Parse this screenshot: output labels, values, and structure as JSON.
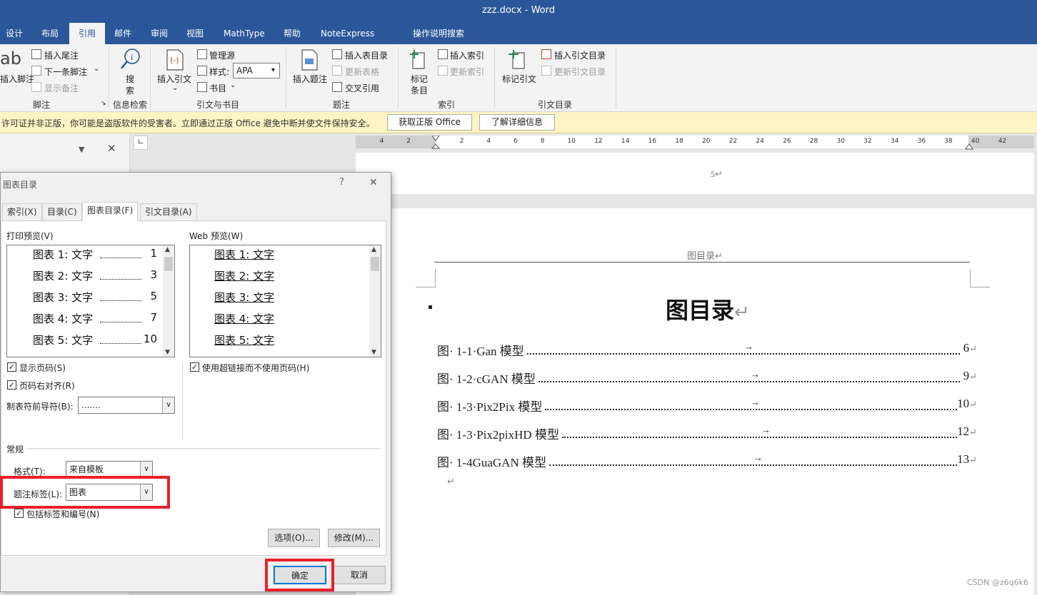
{
  "window": {
    "title": "zzz.docx  -  Word"
  },
  "menu_tabs": [
    {
      "label": "设计"
    },
    {
      "label": "布局"
    },
    {
      "label": "引用"
    },
    {
      "label": "邮件"
    },
    {
      "label": "审阅"
    },
    {
      "label": "视图"
    },
    {
      "label": "MathType"
    },
    {
      "label": "帮助"
    },
    {
      "label": "NoteExpress"
    },
    {
      "label": "操作说明搜索"
    }
  ],
  "ribbon": {
    "footnote": {
      "big_label": "插入脚注",
      "insert_endnote": "插入尾注",
      "next_footnote": "下一条脚注",
      "show_notes": "显示备注",
      "group": "脚注"
    },
    "search": {
      "label_1": "搜",
      "label_2": "索",
      "group": "信息检索"
    },
    "citations": {
      "insert_citation": "插入引文",
      "manage_sources": "管理源",
      "style_label": "样式:",
      "style_value": "APA",
      "bibliography": "书目",
      "group": "引文与书目"
    },
    "captions": {
      "insert_caption": "插入题注",
      "insert_table_of_figures": "插入表目录",
      "update_table": "更新表格",
      "cross_reference": "交叉引用",
      "group": "题注"
    },
    "index": {
      "mark_entry_1": "标记",
      "mark_entry_2": "条目",
      "insert_index": "插入索引",
      "update_index": "更新索引",
      "group": "索引"
    },
    "toa": {
      "mark_citation": "标记引文",
      "insert_toa": "插入引文目录",
      "update_toa": "更新引文目录",
      "group": "引文目录"
    },
    "big_icon_text": "ab"
  },
  "message_bar": {
    "text": "许可证并非正版，你可能是盗版软件的受害者。立即通过正版 Office 避免中断并使文件保持安全。",
    "btn_genuine": "获取正版 Office",
    "btn_learn": "了解详细信息"
  },
  "ruler": {
    "numbers_left": [
      "4",
      "2"
    ],
    "numbers": [
      "2",
      "4",
      "6",
      "8",
      "10",
      "12",
      "14",
      "16",
      "18",
      "20",
      "22",
      "24",
      "26",
      "28",
      "30",
      "32",
      "34",
      "36",
      "38"
    ],
    "numbers_right": [
      "40",
      "42"
    ]
  },
  "document": {
    "page1_number": "5",
    "header_text": "图目录",
    "heading": "图目录",
    "entries": [
      {
        "label": "图· 1-1·Gan 模型",
        "page": "6"
      },
      {
        "label": "图· 1-2·cGAN 模型",
        "page": "9"
      },
      {
        "label": "图· 1-3·Pix2Pix 模型",
        "page": "10"
      },
      {
        "label": "图· 1-3·Pix2pixHD 模型",
        "page": "12"
      },
      {
        "label": "图· 1-4GuaGAN 模型",
        "page": "13"
      }
    ],
    "return_mark": "↵",
    "tab_arrow": "→"
  },
  "dialog": {
    "title": "图表目录",
    "help": "?",
    "close": "✕",
    "tabs": [
      {
        "label": "索引(X)"
      },
      {
        "label": "目录(C)"
      },
      {
        "label": "图表目录(F)"
      },
      {
        "label": "引文目录(A)"
      }
    ],
    "print_preview_label": "打印预览(V)",
    "web_preview_label": "Web 预览(W)",
    "print_preview": [
      {
        "text": "图表  1:  文字",
        "page": "1"
      },
      {
        "text": "图表  2:  文字",
        "page": "3"
      },
      {
        "text": "图表  3:  文字",
        "page": "5"
      },
      {
        "text": "图表  4:  文字",
        "page": "7"
      },
      {
        "text": "图表  5:  文字",
        "page": "10"
      }
    ],
    "web_preview": [
      "图表  1:  文字",
      "图表  2:  文字",
      "图表  3:  文字",
      "图表  4:  文字",
      "图表  5:  文字"
    ],
    "show_page_numbers": "显示页码(S)",
    "right_align": "页码右对齐(R)",
    "use_hyperlinks": "使用超链接而不使用页码(H)",
    "tab_leader_label": "制表符前导符(B):",
    "tab_leader_value": ".......",
    "general_label": "常规",
    "format_label": "格式(T):",
    "format_value": "来自模板",
    "caption_label_label": "题注标签(L):",
    "caption_label_value": "图表",
    "include_label": "包括标签和编号(N)",
    "options_btn": "选项(O)...",
    "modify_btn": "修改(M)...",
    "ok_btn": "确定",
    "cancel_btn": "取消",
    "check_mark": "✓"
  },
  "watermark": "CSDN @z6q6k6",
  "colors": {
    "word_blue": "#2b579a",
    "highlight_red": "#e8202a",
    "message_yellow": "#fdf4c5"
  }
}
